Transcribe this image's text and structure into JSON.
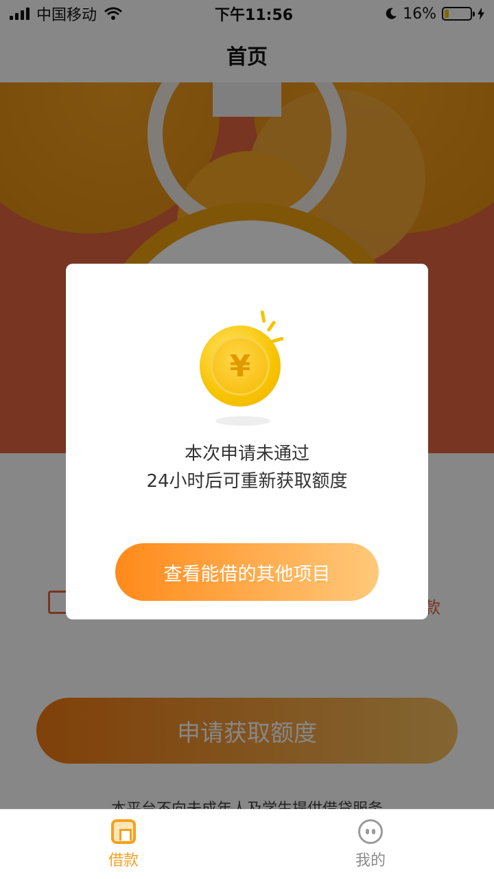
{
  "status_bar": {
    "carrier": "中国移动",
    "time": "下午11:56",
    "battery": "16%",
    "battery_level": 0.16,
    "icons": [
      "signal-icon",
      "wifi-icon",
      "moon-icon",
      "battery-icon",
      "charging-icon"
    ]
  },
  "nav": {
    "title": "首页"
  },
  "home": {
    "link_right": "款",
    "apply_button": "申请获取额度",
    "disclaimer": "本平台不向未成年人及学生提供借贷服务"
  },
  "modal": {
    "coin_symbol": "¥",
    "message_line1": "本次申请未通过",
    "message_line2": "24小时后可重新获取额度",
    "button": "查看能借的其他项目"
  },
  "tabbar": {
    "items": [
      {
        "label": "借款",
        "icon": "home-icon",
        "active": true
      },
      {
        "label": "我的",
        "icon": "profile-icon",
        "active": false
      }
    ]
  },
  "colors": {
    "accent": "#f5a020",
    "hero_bg": "#e2643f",
    "modal_button_start": "#ff8a1a",
    "modal_button_end": "#ffc97a"
  }
}
